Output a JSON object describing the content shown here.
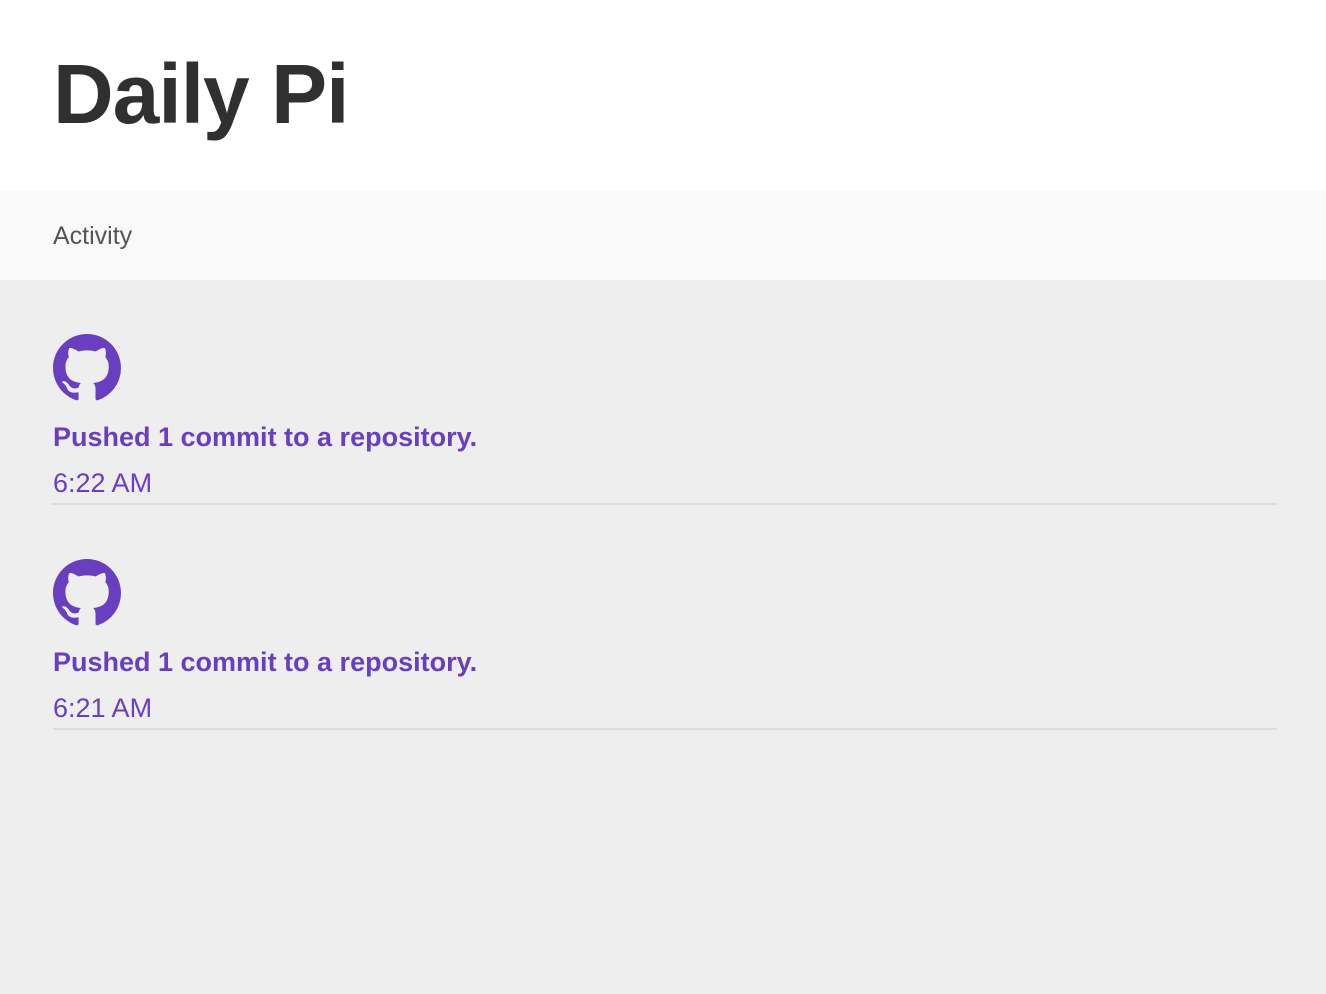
{
  "header": {
    "title": "Daily Pi"
  },
  "tabs": {
    "activity_label": "Activity"
  },
  "theme": {
    "accent": "#6a3fbf",
    "header_bg": "#ffffff",
    "tab_bg": "#f9f9f9",
    "page_bg": "#eeeeee"
  },
  "feed": [
    {
      "icon": "github-icon",
      "title": "Pushed 1 commit to a repository.",
      "time": "6:22 AM"
    },
    {
      "icon": "github-icon",
      "title": "Pushed 1 commit to a repository.",
      "time": "6:21 AM"
    }
  ]
}
